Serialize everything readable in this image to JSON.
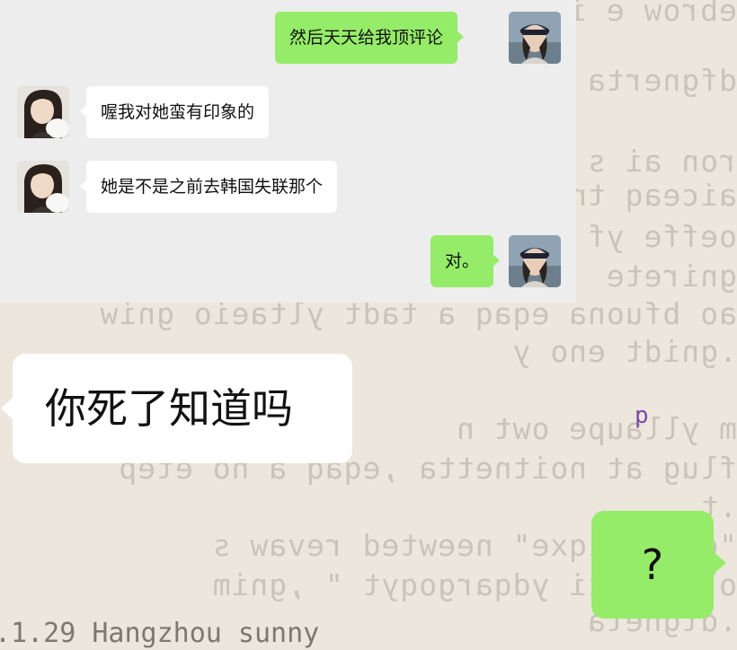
{
  "background_caption": ".1.29 Hangzhou sunny",
  "background_letters": [
    "p",
    "p"
  ],
  "chat": {
    "messages": [
      {
        "side": "right",
        "text": "然后天天给我顶评论",
        "avatar": "avatar-cap-girl"
      },
      {
        "side": "left",
        "text": "喔我对她蛮有印象的",
        "avatar": "avatar-girl-long-hair"
      },
      {
        "side": "left",
        "text": "她是不是之前去韩国失联那个",
        "avatar": "avatar-girl-long-hair"
      },
      {
        "side": "right",
        "text": "对。",
        "avatar": "avatar-cap-girl"
      }
    ]
  },
  "overlay": {
    "left_bubble": "你死了知道吗",
    "right_bubble": "?"
  },
  "colors": {
    "green_bubble": "#95ec69",
    "white_bubble": "#ffffff",
    "panel": "#ededed",
    "background": "#ece6dc"
  }
}
